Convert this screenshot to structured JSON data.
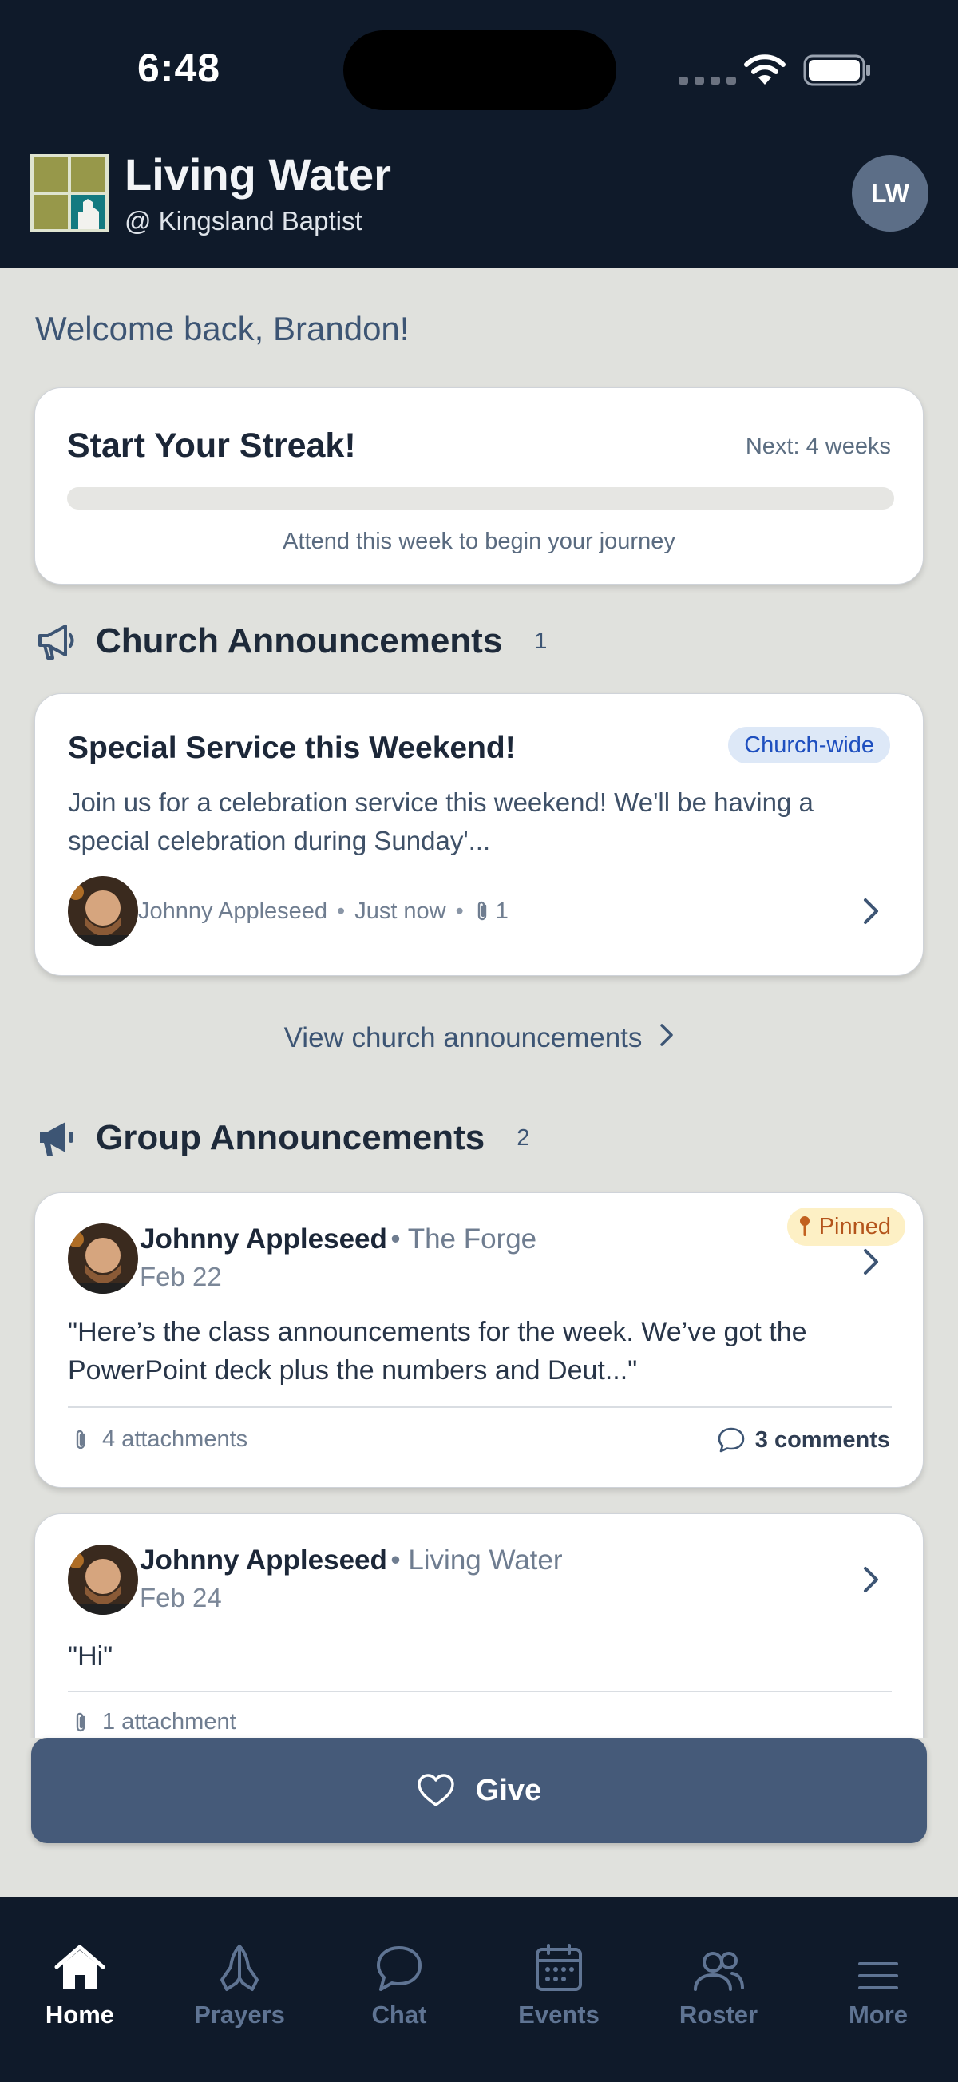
{
  "status_bar": {
    "time": "6:48"
  },
  "header": {
    "title": "Living Water",
    "subtitle": "@ Kingsland Baptist",
    "avatar_initials": "LW"
  },
  "welcome": "Welcome back, Brandon!",
  "streak": {
    "title": "Start Your Streak!",
    "next": "Next: 4 weeks",
    "progress": 0,
    "hint": "Attend this week to begin your journey"
  },
  "church_announcements": {
    "title": "Church Announcements",
    "count": "1",
    "items": [
      {
        "title": "Special Service this Weekend!",
        "scope": "Church-wide",
        "body": "Join us for a celebration service this weekend! We'll be having a special celebration during Sunday'...",
        "author": "Johnny Appleseed",
        "time": "Just now",
        "attachments": "1"
      }
    ],
    "view_link": "View church announcements"
  },
  "group_announcements": {
    "title": "Group Announcements",
    "count": "2",
    "items": [
      {
        "author": "Johnny Appleseed",
        "group": "The Forge",
        "date": "Feb 22",
        "pinned_label": "Pinned",
        "quote": "\"Here’s the class announcements for the week. We’ve got the PowerPoint deck plus the numbers and Deut...\"",
        "attachments": "4 attachments",
        "comments": "3 comments"
      },
      {
        "author": "Johnny Appleseed",
        "group": "Living Water",
        "date": "Feb 24",
        "quote": "\"Hi\"",
        "attachments": "1 attachment"
      }
    ]
  },
  "give_button": "Give",
  "tabs": [
    {
      "label": "Home",
      "icon": "home-icon",
      "active": true
    },
    {
      "label": "Prayers",
      "icon": "praying-hands-icon"
    },
    {
      "label": "Chat",
      "icon": "chat-bubble-icon"
    },
    {
      "label": "Events",
      "icon": "calendar-icon"
    },
    {
      "label": "Roster",
      "icon": "people-icon"
    },
    {
      "label": "More",
      "icon": "menu-icon"
    }
  ],
  "colors": {
    "header_bg": "#0f1a2a",
    "page_bg": "#e0e1dd",
    "accent": "#455a79",
    "scope_badge": "#dde8f7",
    "pinned_badge": "#fdf0c5"
  }
}
